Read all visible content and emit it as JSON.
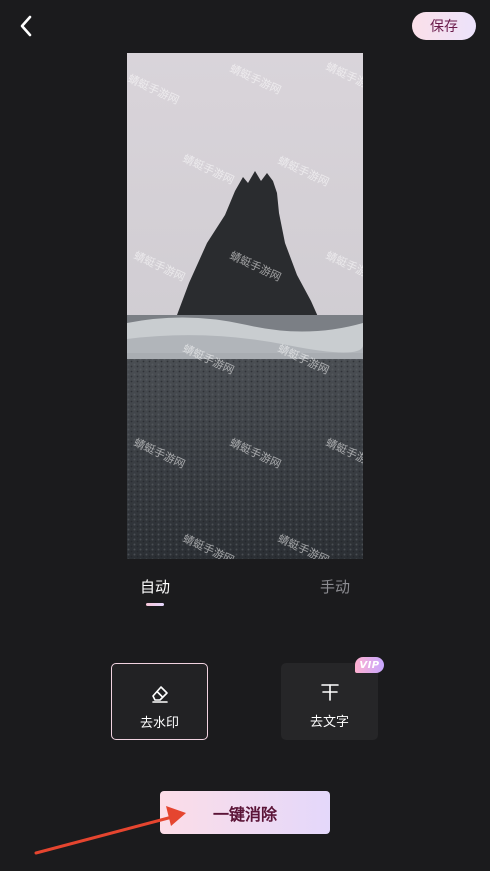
{
  "header": {
    "back_icon": "chevron-left-icon",
    "save_label": "保存"
  },
  "preview": {
    "watermark_text": "蜻蜓手游网",
    "description": "photo"
  },
  "mode_tabs": {
    "auto_label": "自动",
    "manual_label": "手动",
    "active": "auto"
  },
  "tools": {
    "remove_watermark": {
      "label": "去水印",
      "icon": "eraser-icon",
      "selected": true
    },
    "remove_text": {
      "label": "去文字",
      "icon": "text-strikethrough-icon",
      "badge": "VIP"
    }
  },
  "primary_action": {
    "label": "一键消除"
  },
  "colors": {
    "background": "#1b1b1d",
    "accent_pink": "#fbe0e9",
    "accent_lavender": "#e4d8fb",
    "button_text": "#5b1437",
    "annotation_arrow": "#e5452f"
  }
}
